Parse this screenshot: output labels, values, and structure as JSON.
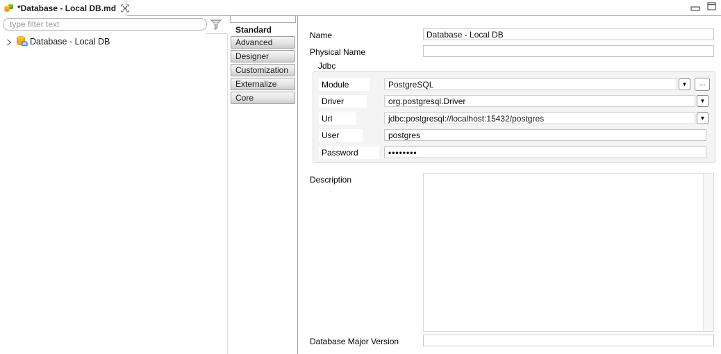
{
  "tab_bar": {
    "title": "*Database - Local DB.md"
  },
  "explorer": {
    "filter_placeholder": "type filter text",
    "tree_items": [
      {
        "label": "Database - Local DB",
        "icon": "database",
        "expandable": true
      }
    ]
  },
  "category_tabs": {
    "selected": "Standard",
    "items": [
      "Standard",
      "Advanced",
      "Designer",
      "Customization",
      "Externalize",
      "Core"
    ]
  },
  "form": {
    "name_label": "Name",
    "name_value": "Database - Local DB",
    "physical_name_label": "Physical Name",
    "physical_name_value": "",
    "jdbc": {
      "group_title": "Jdbc",
      "module_label": "Module",
      "module_value": "PostgreSQL",
      "driver_label": "Driver",
      "driver_value": "org.postgresql.Driver",
      "url_label": "Url",
      "url_value": "jdbc:postgresql://localhost:15432/postgres",
      "user_label": "User",
      "user_value": "postgres",
      "password_label": "Password",
      "password_value": "••••••••",
      "browse_label": "...",
      "dropdown_glyph": "▼"
    },
    "description_label": "Description",
    "description_value": "",
    "db_major_version_label": "Database Major Version",
    "db_major_version_value": ""
  },
  "colors": {
    "tab_border": "#b4b4b4",
    "panel_divider": "#9aa1a9",
    "group_background": "#f4f4f4",
    "input_border": "#c6c6c6",
    "button_gradient_top": "#f6f6f6",
    "button_gradient_bottom": "#cdcdcd"
  }
}
